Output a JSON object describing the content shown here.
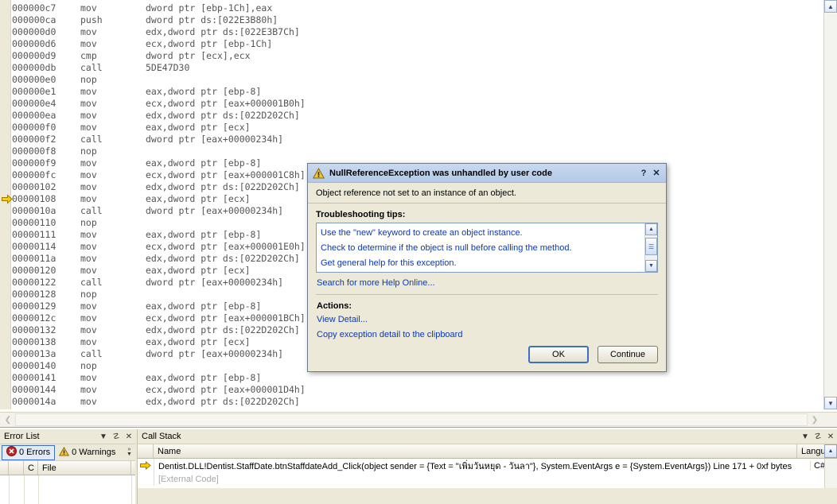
{
  "code_pane": {
    "lines": [
      {
        "addr": "000000c7",
        "mnemonic": "mov",
        "operands": "dword ptr [ebp-1Ch],eax"
      },
      {
        "addr": "000000ca",
        "mnemonic": "push",
        "operands": "dword ptr ds:[022E3B80h]"
      },
      {
        "addr": "000000d0",
        "mnemonic": "mov",
        "operands": "edx,dword ptr ds:[022E3B7Ch]"
      },
      {
        "addr": "000000d6",
        "mnemonic": "mov",
        "operands": "ecx,dword ptr [ebp-1Ch]"
      },
      {
        "addr": "000000d9",
        "mnemonic": "cmp",
        "operands": "dword ptr [ecx],ecx"
      },
      {
        "addr": "000000db",
        "mnemonic": "call",
        "operands": "5DE47D30"
      },
      {
        "addr": "000000e0",
        "mnemonic": "nop",
        "operands": ""
      },
      {
        "addr": "000000e1",
        "mnemonic": "mov",
        "operands": "eax,dword ptr [ebp-8]"
      },
      {
        "addr": "000000e4",
        "mnemonic": "mov",
        "operands": "ecx,dword ptr [eax+000001B0h]"
      },
      {
        "addr": "000000ea",
        "mnemonic": "mov",
        "operands": "edx,dword ptr ds:[022D202Ch]"
      },
      {
        "addr": "000000f0",
        "mnemonic": "mov",
        "operands": "eax,dword ptr [ecx]"
      },
      {
        "addr": "000000f2",
        "mnemonic": "call",
        "operands": "dword ptr [eax+00000234h]"
      },
      {
        "addr": "000000f8",
        "mnemonic": "nop",
        "operands": ""
      },
      {
        "addr": "000000f9",
        "mnemonic": "mov",
        "operands": "eax,dword ptr [ebp-8]"
      },
      {
        "addr": "000000fc",
        "mnemonic": "mov",
        "operands": "ecx,dword ptr [eax+000001C8h]"
      },
      {
        "addr": "00000102",
        "mnemonic": "mov",
        "operands": "edx,dword ptr ds:[022D202Ch]"
      },
      {
        "addr": "00000108",
        "mnemonic": "mov",
        "operands": "eax,dword ptr [ecx]"
      },
      {
        "addr": "0000010a",
        "mnemonic": "call",
        "operands": "dword ptr [eax+00000234h]"
      },
      {
        "addr": "00000110",
        "mnemonic": "nop",
        "operands": ""
      },
      {
        "addr": "00000111",
        "mnemonic": "mov",
        "operands": "eax,dword ptr [ebp-8]"
      },
      {
        "addr": "00000114",
        "mnemonic": "mov",
        "operands": "ecx,dword ptr [eax+000001E0h]"
      },
      {
        "addr": "0000011a",
        "mnemonic": "mov",
        "operands": "edx,dword ptr ds:[022D202Ch]"
      },
      {
        "addr": "00000120",
        "mnemonic": "mov",
        "operands": "eax,dword ptr [ecx]"
      },
      {
        "addr": "00000122",
        "mnemonic": "call",
        "operands": "dword ptr [eax+00000234h]"
      },
      {
        "addr": "00000128",
        "mnemonic": "nop",
        "operands": ""
      },
      {
        "addr": "00000129",
        "mnemonic": "mov",
        "operands": "eax,dword ptr [ebp-8]"
      },
      {
        "addr": "0000012c",
        "mnemonic": "mov",
        "operands": "ecx,dword ptr [eax+000001BCh]"
      },
      {
        "addr": "00000132",
        "mnemonic": "mov",
        "operands": "edx,dword ptr ds:[022D202Ch]"
      },
      {
        "addr": "00000138",
        "mnemonic": "mov",
        "operands": "eax,dword ptr [ecx]"
      },
      {
        "addr": "0000013a",
        "mnemonic": "call",
        "operands": "dword ptr [eax+00000234h]"
      },
      {
        "addr": "00000140",
        "mnemonic": "nop",
        "operands": ""
      },
      {
        "addr": "00000141",
        "mnemonic": "mov",
        "operands": "eax,dword ptr [ebp-8]"
      },
      {
        "addr": "00000144",
        "mnemonic": "mov",
        "operands": "ecx,dword ptr [eax+000001D4h]"
      },
      {
        "addr": "0000014a",
        "mnemonic": "mov",
        "operands": "edx,dword ptr ds:[022D202Ch]"
      }
    ],
    "execution_arrow_line_index": 16
  },
  "dialog": {
    "title": "NullReferenceException was unhandled by user code",
    "title_icon": "warning-triangle-icon",
    "help_button": "?",
    "close_button": "✕",
    "message": "Object reference not set to an instance of an object.",
    "tips_heading": "Troubleshooting tips:",
    "tips": [
      "Use the \"new\" keyword to create an object instance.",
      "Check to determine if the object is null before calling the method.",
      "Get general help for this exception."
    ],
    "search_help_link": "Search for more Help Online...",
    "actions_heading": "Actions:",
    "actions": [
      "View Detail...",
      "Copy exception detail to the clipboard"
    ],
    "buttons": {
      "ok": "OK",
      "continue": "Continue"
    }
  },
  "error_list": {
    "title": "Error List",
    "errors_label": "0 Errors",
    "warnings_label": "0 Warnings",
    "columns": [
      "",
      "",
      "C",
      "File"
    ],
    "rows": []
  },
  "call_stack": {
    "title": "Call Stack",
    "columns": [
      "",
      "Name",
      "Langu"
    ],
    "rows": [
      {
        "marker": "current-frame-arrow",
        "name": "Dentist.DLL!Dentist.StaffDate.btnStaffdateAdd_Click(object sender = {Text = \"เพิ่มวันหยุด - วันลา\"}, System.EventArgs e = {System.EventArgs}) Line 171 + 0xf bytes",
        "language": "C#",
        "external": false
      },
      {
        "marker": "",
        "name": "[External Code]",
        "language": "",
        "external": true
      }
    ]
  },
  "panel_buttons": {
    "dropdown": "▼",
    "pin": "☡",
    "close": "✕"
  },
  "colors": {
    "dialog_title_start": "#c9d9ef",
    "dialog_title_end": "#b3c9e8",
    "dialog_face": "#ece9d8",
    "link": "#0b39b5",
    "code_text": "#555555",
    "exec_arrow": "#ffcc00",
    "error_red": "#c0241f",
    "warning_yellow": "#f2c431",
    "focus_border": "#3d6fbe"
  }
}
